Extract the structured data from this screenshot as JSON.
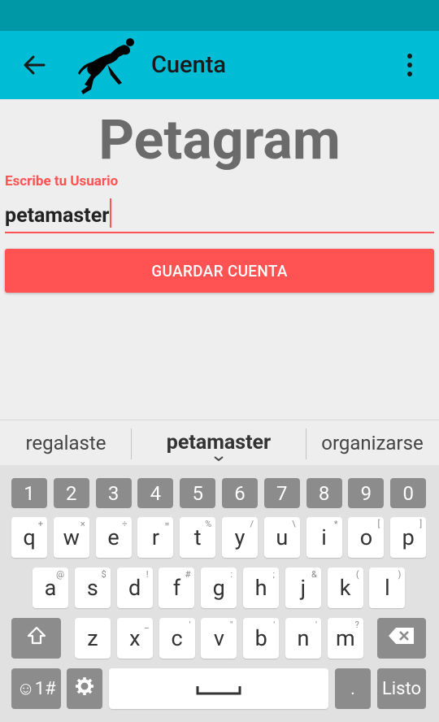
{
  "appbar": {
    "title": "Cuenta"
  },
  "brand": {
    "text": "Petagram"
  },
  "form": {
    "label": "Escribe tu Usuario",
    "value": "petamaster",
    "save_label": "GUARDAR CUENTA"
  },
  "suggestions": [
    "regalaste",
    "petamaster",
    "organizarse"
  ],
  "keyboard": {
    "numbers": [
      "1",
      "2",
      "3",
      "4",
      "5",
      "6",
      "7",
      "8",
      "9",
      "0"
    ],
    "row1": [
      "q",
      "w",
      "e",
      "r",
      "t",
      "y",
      "u",
      "i",
      "o",
      "p"
    ],
    "row1_hints": [
      "+",
      "×",
      "÷",
      "=",
      "%",
      "/",
      "\\",
      "*",
      "[",
      "]"
    ],
    "row2": [
      "a",
      "s",
      "d",
      "f",
      "g",
      "h",
      "j",
      "k",
      "l"
    ],
    "row2_hints": [
      "@",
      "$",
      "!",
      "#",
      ":",
      ";",
      "&",
      "(",
      ")"
    ],
    "row3": [
      "z",
      "x",
      "c",
      "v",
      "b",
      "n",
      "m"
    ],
    "row3_hints": [
      "",
      "_",
      "'",
      "\"",
      "'",
      "'",
      "?"
    ],
    "symbols_label": "☺1#",
    "period_label": ".",
    "done_label": "Listo"
  },
  "colors": {
    "statusbar": "#0097a7",
    "appbar": "#00bcd4",
    "accent": "#ff5252"
  }
}
